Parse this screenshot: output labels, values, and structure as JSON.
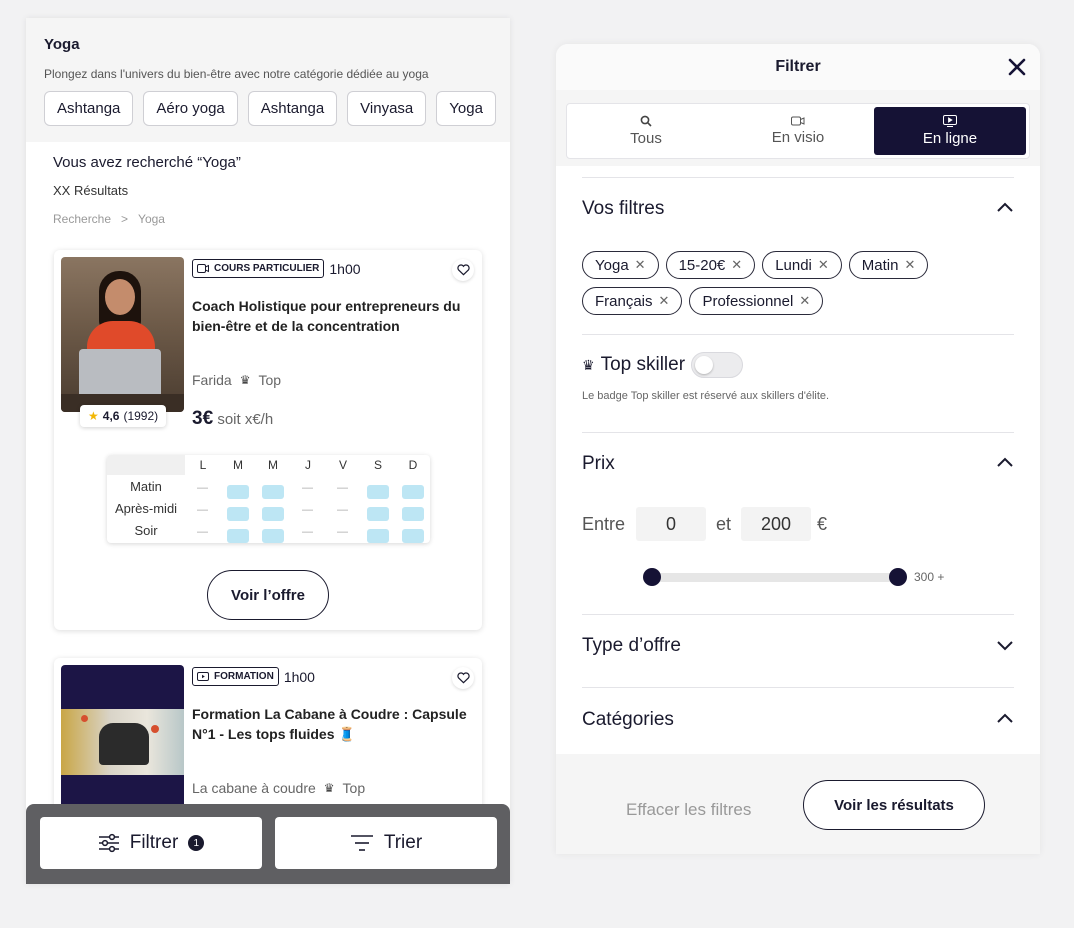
{
  "category": {
    "title": "Yoga",
    "description": "Plongez dans l'univers du bien-être avec notre catégorie dédiée au yoga",
    "chips": [
      "Ashtanga",
      "Aéro yoga",
      "Ashtanga",
      "Vinyasa",
      "Yoga"
    ]
  },
  "search": {
    "title": "Vous avez recherché “Yoga”",
    "results": "XX Résultats",
    "breadcrumb": [
      "Recherche",
      ">",
      "Yoga"
    ]
  },
  "cards": [
    {
      "badge": "COURS PARTICULIER",
      "duration": "1h00",
      "title": "Coach Holistique pour entrepreneurs du bien-être et de la concentration",
      "coach": "Farida",
      "top_label": "Top",
      "rating": "4,6",
      "rating_count": "(1992)",
      "price": "3€",
      "price_suffix": "soit x€/h",
      "cta": "Voir l’offre"
    },
    {
      "badge": "FORMATION",
      "duration": "1h00",
      "title": "Formation La Cabane à Coudre : Capsule N°1 - Les tops fluides 🧵",
      "coach": "La cabane à coudre",
      "top_label": "Top"
    }
  ],
  "schedule": {
    "days": [
      "L",
      "M",
      "M",
      "J",
      "V",
      "S",
      "D"
    ],
    "slots": [
      {
        "label": "Matin",
        "cells": [
          0,
          1,
          1,
          0,
          0,
          1,
          1
        ]
      },
      {
        "label": "Après-midi",
        "cells": [
          0,
          1,
          1,
          0,
          0,
          1,
          1
        ]
      },
      {
        "label": "Soir",
        "cells": [
          0,
          1,
          1,
          0,
          0,
          1,
          1
        ]
      }
    ]
  },
  "bottom_bar": {
    "filter": "Filtrer",
    "filter_count": "1",
    "sort": "Trier"
  },
  "panel": {
    "title": "Filtrer",
    "modes": [
      "Tous",
      "En visio",
      "En ligne"
    ],
    "active_mode": "En ligne",
    "your_filters": "Vos filtres",
    "tags": [
      "Yoga",
      "15-20€",
      "Lundi",
      "Matin",
      "Français",
      "Professionnel"
    ],
    "top_skiller": "Top skiller",
    "top_skiller_note": "Le badge Top skiller est réservé aux skillers d'élite.",
    "price_title": "Prix",
    "between": "Entre",
    "min": "0",
    "and": "et",
    "max": "200",
    "currency": "€",
    "slider_max": "300 +",
    "offer_type": "Type d’offre",
    "categories": "Catégories",
    "clear": "Effacer les filtres",
    "see_results": "Voir les résultats"
  },
  "colors": {
    "navy": "#151235",
    "slot_on": "#bde6f4",
    "star": "#f2b705"
  }
}
